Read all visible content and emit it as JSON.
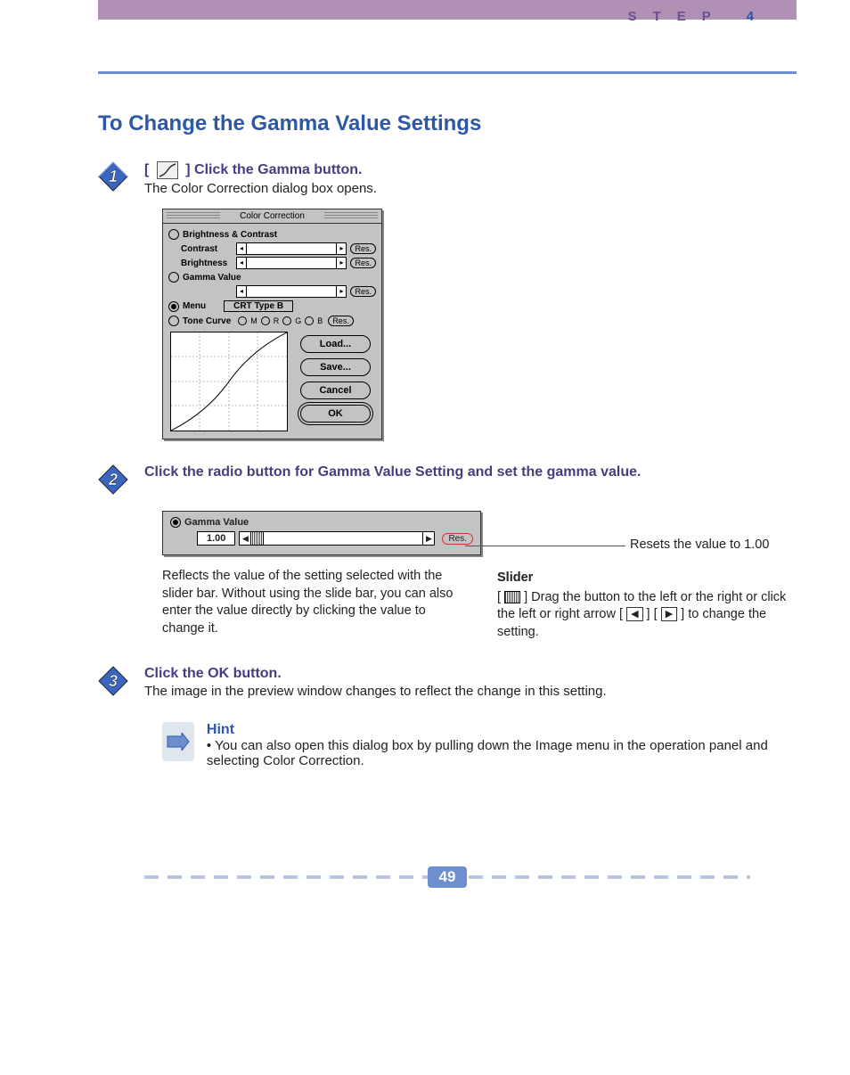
{
  "header": {
    "step_label": "STEP",
    "step_num": "4"
  },
  "title": "To Change the Gamma Value Settings",
  "steps": {
    "s1": {
      "head_prefix": "[",
      "head_suffix": "] Click the Gamma button.",
      "sub": "The Color Correction dialog box opens."
    },
    "s2": {
      "head": "Click the radio button for Gamma Value Setting and set the gamma value."
    },
    "s3": {
      "head": "Click the OK button.",
      "sub": "The image in the preview window changes to reflect the change in this setting."
    }
  },
  "dialog": {
    "title": "Color Correction",
    "r_bc": "Brightness & Contrast",
    "lbl_contrast": "Contrast",
    "lbl_brightness": "Brightness",
    "r_gamma": "Gamma Value",
    "r_menu": "Menu",
    "crt": "CRT Type B",
    "r_tone": "Tone Curve",
    "tone_opts": {
      "m": "M",
      "r": "R",
      "g": "G",
      "b": "B"
    },
    "res": "Res.",
    "btn_load": "Load...",
    "btn_save": "Save...",
    "btn_cancel": "Cancel",
    "btn_ok": "OK"
  },
  "gamma_panel": {
    "label": "Gamma Value",
    "value": "1.00",
    "res": "Res."
  },
  "notes": {
    "reset_text": "Resets the value to 1.00",
    "left": "Reflects the value of the setting selected with the slider bar. Without using the slide bar, you can also enter the value directly by clicking the value to change it.",
    "slider_title": "Slider",
    "right_1": "[ ",
    "right_2": " ] Drag the button to the left or the right or click the left or right arrow [ ",
    "right_3": " ] [ ",
    "right_4": " ] to change the setting."
  },
  "hint": {
    "title": "Hint",
    "text": "• You can also open this dialog box by pulling down the Image menu in the operation panel and selecting Color Correction."
  },
  "page_num": "49"
}
